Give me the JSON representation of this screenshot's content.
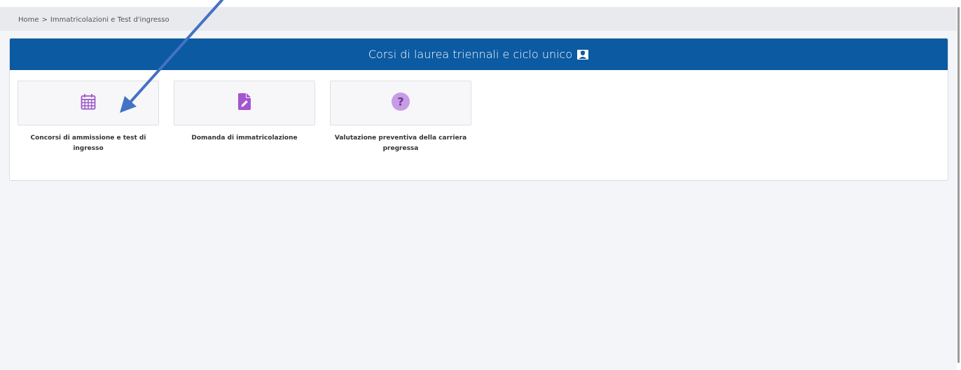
{
  "breadcrumb": {
    "home": "Home",
    "separator": ">",
    "current": "Immatricolazioni e Test d'ingresso"
  },
  "section": {
    "title": "Corsi di laurea triennali e ciclo unico",
    "title_icon": "graduate-icon",
    "header_color": "#0b5aa2"
  },
  "tiles": [
    {
      "label": "Concorsi di ammissione e test di ingresso",
      "icon": "calendar-icon",
      "icon_color": "#9b59c9"
    },
    {
      "label": "Domanda di immatricolazione",
      "icon": "file-edit-icon",
      "icon_color": "#a455d0"
    },
    {
      "label": "Valutazione preventiva della carriera pregressa",
      "icon": "question-icon",
      "icon_color": "#c79be6"
    }
  ],
  "annotation": {
    "arrow_color": "#4472c4"
  }
}
